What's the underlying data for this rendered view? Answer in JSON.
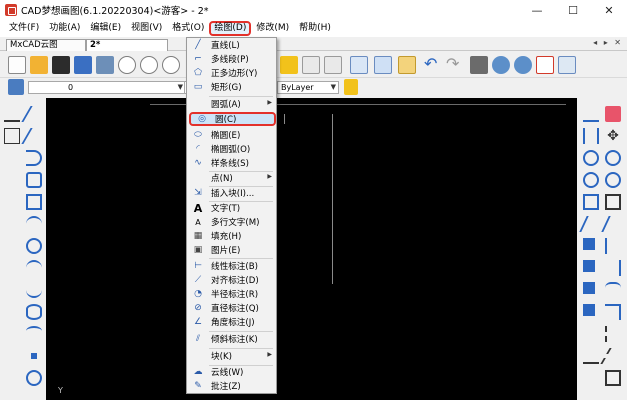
{
  "window": {
    "title": "CAD梦想画图(6.1.20220304)<游客> - 2*",
    "minimize": "—",
    "maximize": "☐",
    "close": "✕"
  },
  "menubar": {
    "items": [
      "文件(F)",
      "功能(A)",
      "编辑(E)",
      "视图(V)",
      "格式(O)",
      "绘图(D)",
      "修改(M)",
      "帮助(H)"
    ],
    "active_index": 5
  },
  "tabs": [
    {
      "label": "MxCAD云图"
    },
    {
      "label": "2*"
    }
  ],
  "tab_controls": "◂ ▸ ✕",
  "toolbar": {
    "layer_value": "0",
    "color_value": "B",
    "linetype_value": "ByLayer"
  },
  "canvas": {
    "axis_label": "Y"
  },
  "draw_menu": {
    "items": [
      {
        "label": "直线(L)",
        "icon": "line-icon",
        "glyph": "╱"
      },
      {
        "label": "多线段(P)",
        "icon": "polyline-icon",
        "glyph": "⌐"
      },
      {
        "label": "正多边形(Y)",
        "icon": "polygon-icon",
        "glyph": "⬠"
      },
      {
        "label": "矩形(G)",
        "icon": "rectangle-icon",
        "glyph": "▭"
      },
      {
        "label": "圆弧(A)",
        "icon": "arc-icon",
        "glyph": "",
        "submenu": true
      },
      {
        "label": "圆(C)",
        "icon": "circle-icon",
        "glyph": "◎",
        "highlighted": true
      },
      {
        "label": "椭圆(E)",
        "icon": "ellipse-icon",
        "glyph": "⬭"
      },
      {
        "label": "椭圆弧(O)",
        "icon": "elliptical-arc-icon",
        "glyph": "◜"
      },
      {
        "label": "样条线(S)",
        "icon": "spline-icon",
        "glyph": "∿"
      },
      {
        "label": "点(N)",
        "icon": "point-icon",
        "glyph": "",
        "submenu": true
      },
      {
        "label": "插入块(I)...",
        "icon": "insert-block-icon",
        "glyph": "⇲"
      },
      {
        "label": "文字(T)",
        "icon": "text-icon",
        "glyph": "A"
      },
      {
        "label": "多行文字(M)",
        "icon": "mtext-icon",
        "glyph": "A"
      },
      {
        "label": "填充(H)",
        "icon": "hatch-icon",
        "glyph": "▦"
      },
      {
        "label": "图片(E)",
        "icon": "image-icon",
        "glyph": "▣"
      },
      {
        "label": "线性标注(B)",
        "icon": "linear-dim-icon",
        "glyph": "⊢"
      },
      {
        "label": "对齐标注(D)",
        "icon": "aligned-dim-icon",
        "glyph": "⟋"
      },
      {
        "label": "半径标注(R)",
        "icon": "radius-dim-icon",
        "glyph": "◔"
      },
      {
        "label": "直径标注(Q)",
        "icon": "diameter-dim-icon",
        "glyph": "⊘"
      },
      {
        "label": "角度标注(J)",
        "icon": "angle-dim-icon",
        "glyph": "∠"
      },
      {
        "label": "倾斜标注(K)",
        "icon": "oblique-dim-icon",
        "glyph": "⫽"
      },
      {
        "label": "块(K)",
        "icon": "block-icon",
        "glyph": "",
        "submenu": true
      },
      {
        "label": "云线(W)",
        "icon": "revcloud-icon",
        "glyph": "☁"
      },
      {
        "label": "批注(Z)",
        "icon": "annotation-icon",
        "glyph": "✎"
      }
    ],
    "submenu_arrow": "▶"
  },
  "colors": {
    "highlight_border": "#e3312b",
    "highlight_fill": "#cde4f7",
    "canvas": "#000000"
  }
}
